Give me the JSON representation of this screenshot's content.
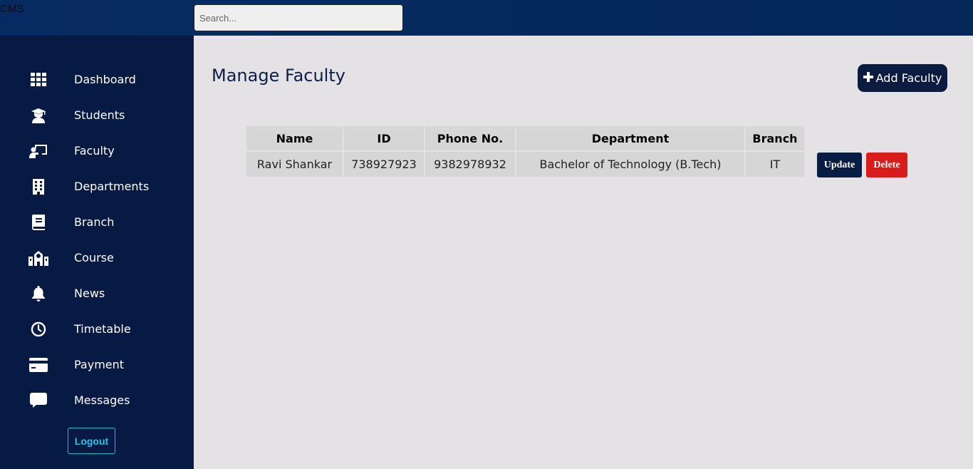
{
  "header": {
    "brand": "CMS",
    "search_placeholder": "Search..."
  },
  "sidebar": {
    "items": [
      {
        "label": "Dashboard",
        "icon": "grid-icon"
      },
      {
        "label": "Students",
        "icon": "graduate-icon"
      },
      {
        "label": "Faculty",
        "icon": "teacher-board-icon"
      },
      {
        "label": "Departments",
        "icon": "building-icon"
      },
      {
        "label": "Branch",
        "icon": "book-icon"
      },
      {
        "label": "Course",
        "icon": "school-icon"
      },
      {
        "label": "News",
        "icon": "bell-icon"
      },
      {
        "label": "Timetable",
        "icon": "clock-icon"
      },
      {
        "label": "Payment",
        "icon": "credit-card-icon"
      },
      {
        "label": "Messages",
        "icon": "message-icon"
      }
    ],
    "logout_label": "Logout"
  },
  "main": {
    "title": "Manage Faculty",
    "add_button_label": "Add Faculty",
    "table": {
      "columns": [
        "Name",
        "ID",
        "Phone No.",
        "Department",
        "Branch"
      ],
      "rows": [
        {
          "name": "Ravi Shankar",
          "id": "738927923",
          "phone": "9382978932",
          "department": "Bachelor of Technology (B.Tech)",
          "branch": "IT"
        }
      ]
    },
    "update_label": "Update",
    "delete_label": "Delete"
  },
  "colors": {
    "sidebar_bg": "#061a43",
    "topbar_bg": "#062a5e",
    "content_bg": "#e4e2e5",
    "accent_dark": "#0b1c40",
    "delete_red": "#d81b1b",
    "logout_cyan": "#29c6e6"
  }
}
